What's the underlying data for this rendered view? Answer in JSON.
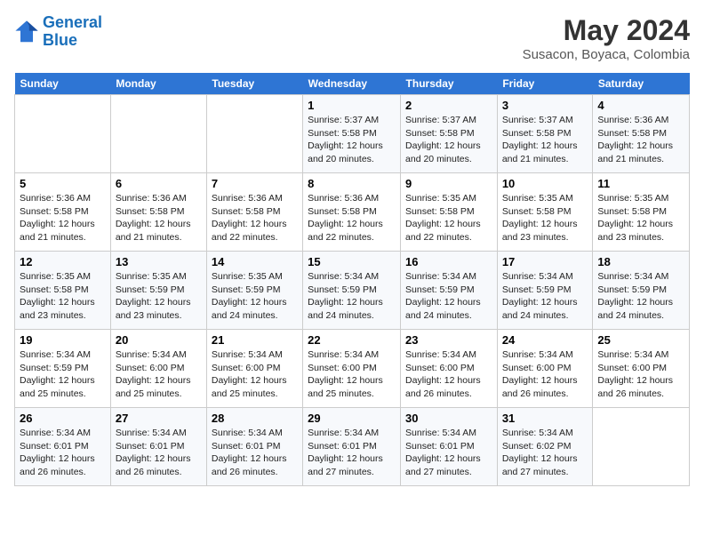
{
  "header": {
    "logo_line1": "General",
    "logo_line2": "Blue",
    "month": "May 2024",
    "location": "Susacon, Boyaca, Colombia"
  },
  "weekdays": [
    "Sunday",
    "Monday",
    "Tuesday",
    "Wednesday",
    "Thursday",
    "Friday",
    "Saturday"
  ],
  "weeks": [
    [
      {
        "day": "",
        "sunrise": "",
        "sunset": "",
        "daylight": ""
      },
      {
        "day": "",
        "sunrise": "",
        "sunset": "",
        "daylight": ""
      },
      {
        "day": "",
        "sunrise": "",
        "sunset": "",
        "daylight": ""
      },
      {
        "day": "1",
        "sunrise": "Sunrise: 5:37 AM",
        "sunset": "Sunset: 5:58 PM",
        "daylight": "Daylight: 12 hours and 20 minutes."
      },
      {
        "day": "2",
        "sunrise": "Sunrise: 5:37 AM",
        "sunset": "Sunset: 5:58 PM",
        "daylight": "Daylight: 12 hours and 20 minutes."
      },
      {
        "day": "3",
        "sunrise": "Sunrise: 5:37 AM",
        "sunset": "Sunset: 5:58 PM",
        "daylight": "Daylight: 12 hours and 21 minutes."
      },
      {
        "day": "4",
        "sunrise": "Sunrise: 5:36 AM",
        "sunset": "Sunset: 5:58 PM",
        "daylight": "Daylight: 12 hours and 21 minutes."
      }
    ],
    [
      {
        "day": "5",
        "sunrise": "Sunrise: 5:36 AM",
        "sunset": "Sunset: 5:58 PM",
        "daylight": "Daylight: 12 hours and 21 minutes."
      },
      {
        "day": "6",
        "sunrise": "Sunrise: 5:36 AM",
        "sunset": "Sunset: 5:58 PM",
        "daylight": "Daylight: 12 hours and 21 minutes."
      },
      {
        "day": "7",
        "sunrise": "Sunrise: 5:36 AM",
        "sunset": "Sunset: 5:58 PM",
        "daylight": "Daylight: 12 hours and 22 minutes."
      },
      {
        "day": "8",
        "sunrise": "Sunrise: 5:36 AM",
        "sunset": "Sunset: 5:58 PM",
        "daylight": "Daylight: 12 hours and 22 minutes."
      },
      {
        "day": "9",
        "sunrise": "Sunrise: 5:35 AM",
        "sunset": "Sunset: 5:58 PM",
        "daylight": "Daylight: 12 hours and 22 minutes."
      },
      {
        "day": "10",
        "sunrise": "Sunrise: 5:35 AM",
        "sunset": "Sunset: 5:58 PM",
        "daylight": "Daylight: 12 hours and 23 minutes."
      },
      {
        "day": "11",
        "sunrise": "Sunrise: 5:35 AM",
        "sunset": "Sunset: 5:58 PM",
        "daylight": "Daylight: 12 hours and 23 minutes."
      }
    ],
    [
      {
        "day": "12",
        "sunrise": "Sunrise: 5:35 AM",
        "sunset": "Sunset: 5:58 PM",
        "daylight": "Daylight: 12 hours and 23 minutes."
      },
      {
        "day": "13",
        "sunrise": "Sunrise: 5:35 AM",
        "sunset": "Sunset: 5:59 PM",
        "daylight": "Daylight: 12 hours and 23 minutes."
      },
      {
        "day": "14",
        "sunrise": "Sunrise: 5:35 AM",
        "sunset": "Sunset: 5:59 PM",
        "daylight": "Daylight: 12 hours and 24 minutes."
      },
      {
        "day": "15",
        "sunrise": "Sunrise: 5:34 AM",
        "sunset": "Sunset: 5:59 PM",
        "daylight": "Daylight: 12 hours and 24 minutes."
      },
      {
        "day": "16",
        "sunrise": "Sunrise: 5:34 AM",
        "sunset": "Sunset: 5:59 PM",
        "daylight": "Daylight: 12 hours and 24 minutes."
      },
      {
        "day": "17",
        "sunrise": "Sunrise: 5:34 AM",
        "sunset": "Sunset: 5:59 PM",
        "daylight": "Daylight: 12 hours and 24 minutes."
      },
      {
        "day": "18",
        "sunrise": "Sunrise: 5:34 AM",
        "sunset": "Sunset: 5:59 PM",
        "daylight": "Daylight: 12 hours and 24 minutes."
      }
    ],
    [
      {
        "day": "19",
        "sunrise": "Sunrise: 5:34 AM",
        "sunset": "Sunset: 5:59 PM",
        "daylight": "Daylight: 12 hours and 25 minutes."
      },
      {
        "day": "20",
        "sunrise": "Sunrise: 5:34 AM",
        "sunset": "Sunset: 6:00 PM",
        "daylight": "Daylight: 12 hours and 25 minutes."
      },
      {
        "day": "21",
        "sunrise": "Sunrise: 5:34 AM",
        "sunset": "Sunset: 6:00 PM",
        "daylight": "Daylight: 12 hours and 25 minutes."
      },
      {
        "day": "22",
        "sunrise": "Sunrise: 5:34 AM",
        "sunset": "Sunset: 6:00 PM",
        "daylight": "Daylight: 12 hours and 25 minutes."
      },
      {
        "day": "23",
        "sunrise": "Sunrise: 5:34 AM",
        "sunset": "Sunset: 6:00 PM",
        "daylight": "Daylight: 12 hours and 26 minutes."
      },
      {
        "day": "24",
        "sunrise": "Sunrise: 5:34 AM",
        "sunset": "Sunset: 6:00 PM",
        "daylight": "Daylight: 12 hours and 26 minutes."
      },
      {
        "day": "25",
        "sunrise": "Sunrise: 5:34 AM",
        "sunset": "Sunset: 6:00 PM",
        "daylight": "Daylight: 12 hours and 26 minutes."
      }
    ],
    [
      {
        "day": "26",
        "sunrise": "Sunrise: 5:34 AM",
        "sunset": "Sunset: 6:01 PM",
        "daylight": "Daylight: 12 hours and 26 minutes."
      },
      {
        "day": "27",
        "sunrise": "Sunrise: 5:34 AM",
        "sunset": "Sunset: 6:01 PM",
        "daylight": "Daylight: 12 hours and 26 minutes."
      },
      {
        "day": "28",
        "sunrise": "Sunrise: 5:34 AM",
        "sunset": "Sunset: 6:01 PM",
        "daylight": "Daylight: 12 hours and 26 minutes."
      },
      {
        "day": "29",
        "sunrise": "Sunrise: 5:34 AM",
        "sunset": "Sunset: 6:01 PM",
        "daylight": "Daylight: 12 hours and 27 minutes."
      },
      {
        "day": "30",
        "sunrise": "Sunrise: 5:34 AM",
        "sunset": "Sunset: 6:01 PM",
        "daylight": "Daylight: 12 hours and 27 minutes."
      },
      {
        "day": "31",
        "sunrise": "Sunrise: 5:34 AM",
        "sunset": "Sunset: 6:02 PM",
        "daylight": "Daylight: 12 hours and 27 minutes."
      },
      {
        "day": "",
        "sunrise": "",
        "sunset": "",
        "daylight": ""
      }
    ]
  ]
}
